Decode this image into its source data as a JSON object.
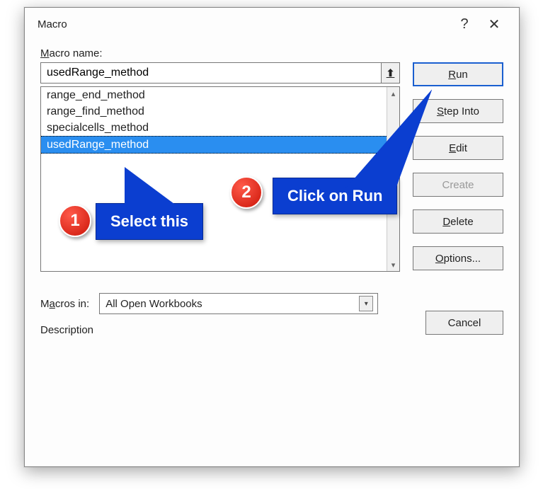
{
  "dialog": {
    "title": "Macro",
    "help": "?",
    "close": "✕"
  },
  "fields": {
    "macro_name_label_pre": "M",
    "macro_name_label_post": "acro name:",
    "macros_in_label_pre": "M",
    "macros_in_label_post": "acros in:",
    "description_label": "Description"
  },
  "name_input_value": "usedRange_method",
  "macros_in": {
    "selected": "All Open Workbooks"
  },
  "list": {
    "items": [
      {
        "label": "range_end_method",
        "selected": false
      },
      {
        "label": "range_find_method",
        "selected": false
      },
      {
        "label": "specialcells_method",
        "selected": false
      },
      {
        "label": "usedRange_method",
        "selected": true
      }
    ]
  },
  "buttons": {
    "run_u": "R",
    "run_rest": "un",
    "step_pre": "S",
    "step_rest": "tep Into",
    "edit_u": "E",
    "edit_rest": "dit",
    "create": "Create",
    "delete_u": "D",
    "delete_rest": "elete",
    "options_u": "O",
    "options_rest": "ptions...",
    "cancel": "Cancel"
  },
  "callouts": {
    "c1_text": "Select this",
    "c1_num": "1",
    "c2_text": "Click on Run",
    "c2_num": "2"
  },
  "icons": {
    "up_arrow": "⬆",
    "scroll_up": "▴",
    "scroll_down": "▾",
    "dd_arrow": "▾"
  }
}
